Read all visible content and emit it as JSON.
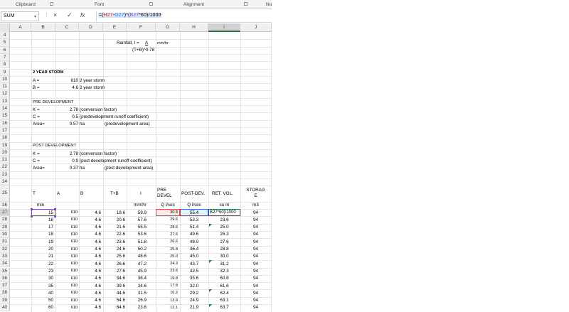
{
  "ribbon": {
    "groups": [
      "Clipboard",
      "Font",
      "Alignment",
      "Nu"
    ]
  },
  "formula_bar": {
    "name_box": "SUM",
    "cancel_icon": "×",
    "enter_icon": "✓",
    "fx_icon": "fx",
    "formula_parts": [
      "=(",
      "H27",
      "-",
      "G27",
      ")*(",
      "B27",
      "*60)/1000"
    ]
  },
  "columns": [
    "A",
    "B",
    "C",
    "D",
    "E",
    "F",
    "G",
    "H",
    "I",
    "J"
  ],
  "selected_column": "I",
  "selected_row": "27",
  "rows": [
    "4",
    "5",
    "6",
    "7",
    "8",
    "9",
    "10",
    "11",
    "12",
    "13",
    "14",
    "15",
    "16",
    "17",
    "18",
    "19",
    "20",
    "21",
    "22",
    "23",
    "24",
    "25",
    "26",
    "27",
    "28",
    "29",
    "30",
    "31",
    "32",
    "33",
    "34",
    "35",
    "36",
    "37",
    "38",
    "39",
    "40"
  ],
  "header_block": {
    "rainfall_label": "Rainfall, I =",
    "rainfall_numerator": "A",
    "rainfall_units": "mm/hr",
    "rainfall_denominator": "(T+B)^0.78",
    "storm_title": "2 YEAR STORM",
    "a_label": "A =",
    "a_value": "610",
    "a_note": "2 year storm",
    "b_label": "B =",
    "b_value": "4.6",
    "b_note": "2 year storm",
    "pre_title": "PRE DEVELOPMENT",
    "pre_k_label": "K =",
    "pre_k_value": "2.78",
    "pre_k_note": "(conversion factor)",
    "pre_c_label": "C =",
    "pre_c_value": "0.5",
    "pre_c_note": "(predevelopment runoff coefficient)",
    "pre_area_label": "Area=",
    "pre_area_value": "0.57",
    "pre_area_unit": "ha",
    "pre_area_note": "(predevelopment area)",
    "post_title": "POST DEVELOPMENT",
    "post_k_label": "K =",
    "post_k_value": "2.78",
    "post_k_note": "(conversion factor)",
    "post_c_label": "C =",
    "post_c_value": "0.9",
    "post_c_note": "(post development runoff coefficient)",
    "post_area_label": "Area=",
    "post_area_value": "0.37",
    "post_area_unit": "ha",
    "post_area_note": "(post development area)"
  },
  "table": {
    "headers": {
      "t": "T",
      "a": "A",
      "b": "B",
      "tb": "T+B",
      "i": "I",
      "pre_line1": "PRE",
      "pre_line2": "DEVEL",
      "post": "POST-DEV.",
      "ret": "RET. VOL.",
      "storage_line1": "STORAG",
      "storage_line2": "E"
    },
    "units": {
      "t": "min",
      "i": "mm/hr",
      "pre": "Q l/sec",
      "post": "Q l/sec",
      "ret": "cu m",
      "storage": "m3"
    },
    "editing_formula": "B27*60)/1000",
    "rows": [
      [
        "15",
        "610",
        "4.6",
        "19.6",
        "59.9",
        "30.8",
        "55.4",
        "",
        "94"
      ],
      [
        "16",
        "610",
        "4.6",
        "20.6",
        "57.6",
        "29.6",
        "53.3",
        "23.6",
        "94"
      ],
      [
        "17",
        "610",
        "4.6",
        "21.6",
        "55.5",
        "28.6",
        "51.4",
        "25.0",
        "94"
      ],
      [
        "18",
        "610",
        "4.6",
        "22.6",
        "53.6",
        "27.6",
        "49.6",
        "26.3",
        "94"
      ],
      [
        "19",
        "610",
        "4.6",
        "23.6",
        "51.8",
        "26.6",
        "48.0",
        "27.6",
        "94"
      ],
      [
        "20",
        "610",
        "4.6",
        "24.6",
        "50.2",
        "25.8",
        "46.4",
        "28.8",
        "94"
      ],
      [
        "21",
        "610",
        "4.6",
        "25.6",
        "48.6",
        "25.0",
        "45.0",
        "30.0",
        "94"
      ],
      [
        "22",
        "610",
        "4.6",
        "26.6",
        "47.2",
        "24.3",
        "43.7",
        "31.2",
        "94"
      ],
      [
        "23",
        "610",
        "4.6",
        "27.6",
        "45.9",
        "23.6",
        "42.5",
        "32.3",
        "94"
      ],
      [
        "30",
        "610",
        "4.6",
        "34.6",
        "38.4",
        "19.8",
        "35.6",
        "60.8",
        "94"
      ],
      [
        "35",
        "610",
        "4.6",
        "39.6",
        "34.6",
        "17.8",
        "32.0",
        "61.6",
        "94"
      ],
      [
        "40",
        "610",
        "4.6",
        "44.6",
        "31.5",
        "16.2",
        "29.2",
        "62.4",
        "94"
      ],
      [
        "50",
        "610",
        "4.6",
        "54.6",
        "26.9",
        "13.9",
        "24.9",
        "63.1",
        "94"
      ],
      [
        "60",
        "610",
        "4.6",
        "64.6",
        "23.6",
        "12.1",
        "21.9",
        "63.7",
        "94"
      ]
    ]
  },
  "colors": {
    "excel_green": "#217346",
    "ref_red": "#e04a4a",
    "ref_purple": "#7a4ab5",
    "ref_blue": "#2e6bd6"
  }
}
